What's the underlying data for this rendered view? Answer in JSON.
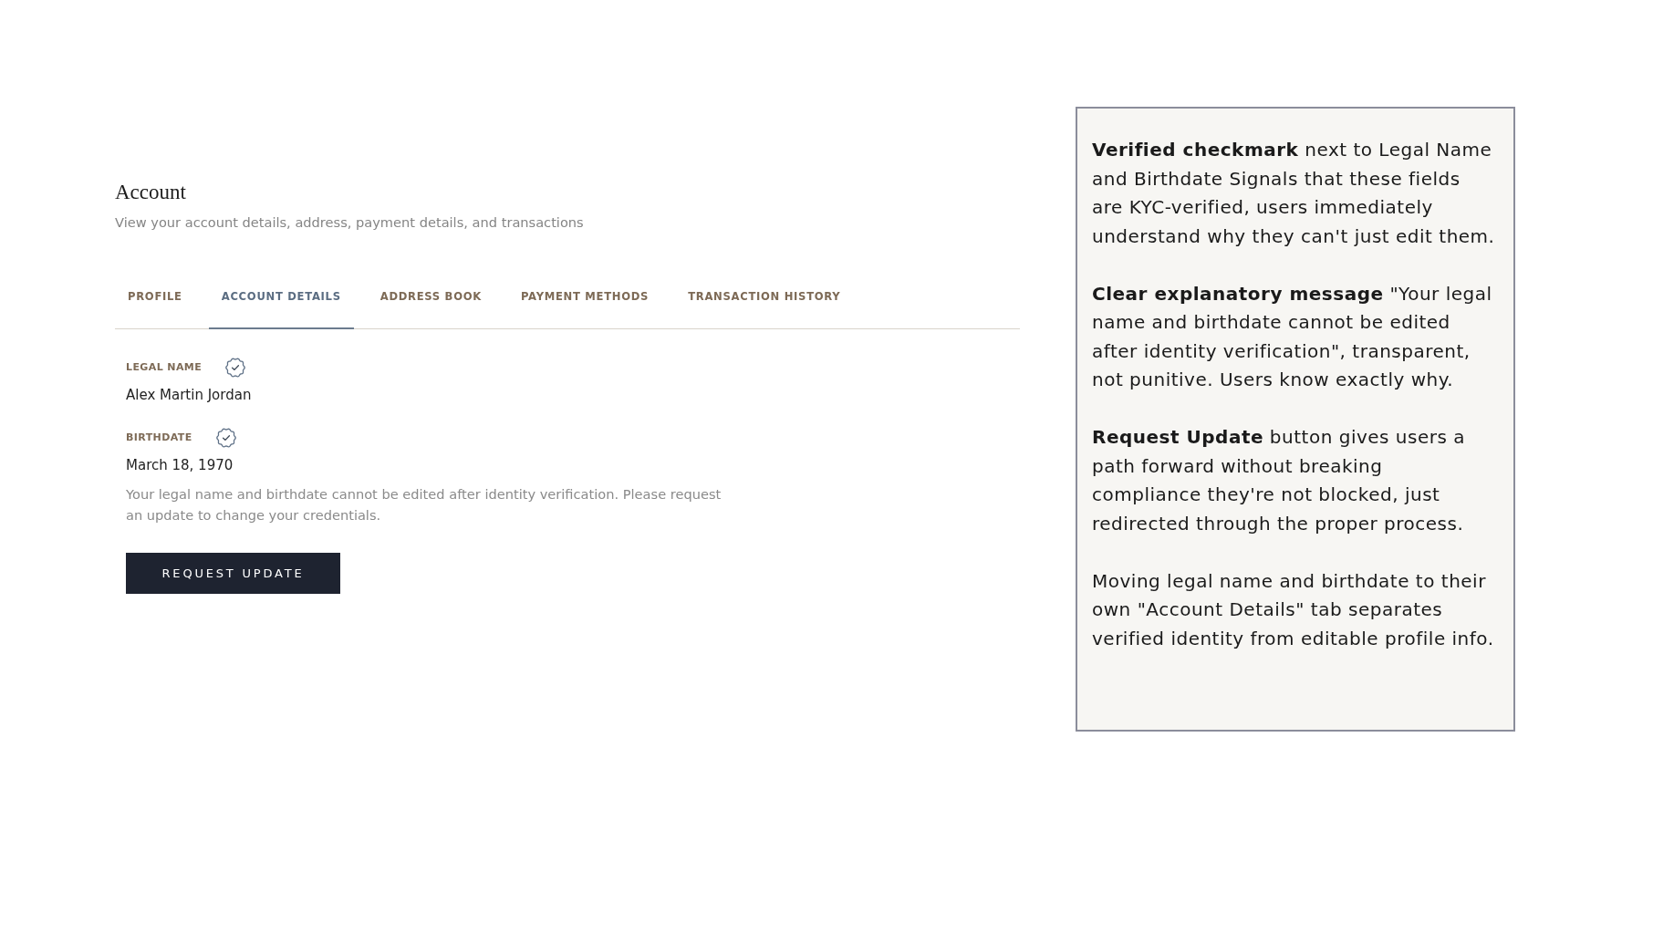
{
  "header": {
    "title": "Account",
    "subtitle": "View your account details, address, payment details, and transactions"
  },
  "tabs": [
    {
      "label": "PROFILE",
      "selected": false
    },
    {
      "label": "ACCOUNT DETAILS",
      "selected": true
    },
    {
      "label": "ADDRESS BOOK",
      "selected": false
    },
    {
      "label": "PAYMENT METHODS",
      "selected": false
    },
    {
      "label": "TRANSACTION HISTORY",
      "selected": false
    }
  ],
  "fields": [
    {
      "label": "LEGAL NAME",
      "verified": true,
      "value": "Alex Martin Jordan"
    },
    {
      "label": "BIRTHDATE",
      "verified": true,
      "value": "March 18, 1970"
    }
  ],
  "notice": "Your legal name and birthdate cannot be edited after identity verification. Please request an update to change your credentials.",
  "button": {
    "label": "REQUEST UPDATE"
  },
  "annotation_panel": {
    "notes": [
      "**Verified checkmark** next to Legal Name and Birthdate Signals that these fields are KYC-verified, users immediately understand why they can't just edit them.",
      "**Clear explanatory message** \"Your legal name and birthdate cannot be edited after identity verification\", transparent, not punitive. Users know exactly why.",
      "**Request Update** button gives users a path forward without breaking compliance they're not blocked, just redirected through the proper process.",
      "Moving legal name and birthdate to their own \"Account Details\" tab separates verified identity from editable profile info."
    ]
  }
}
